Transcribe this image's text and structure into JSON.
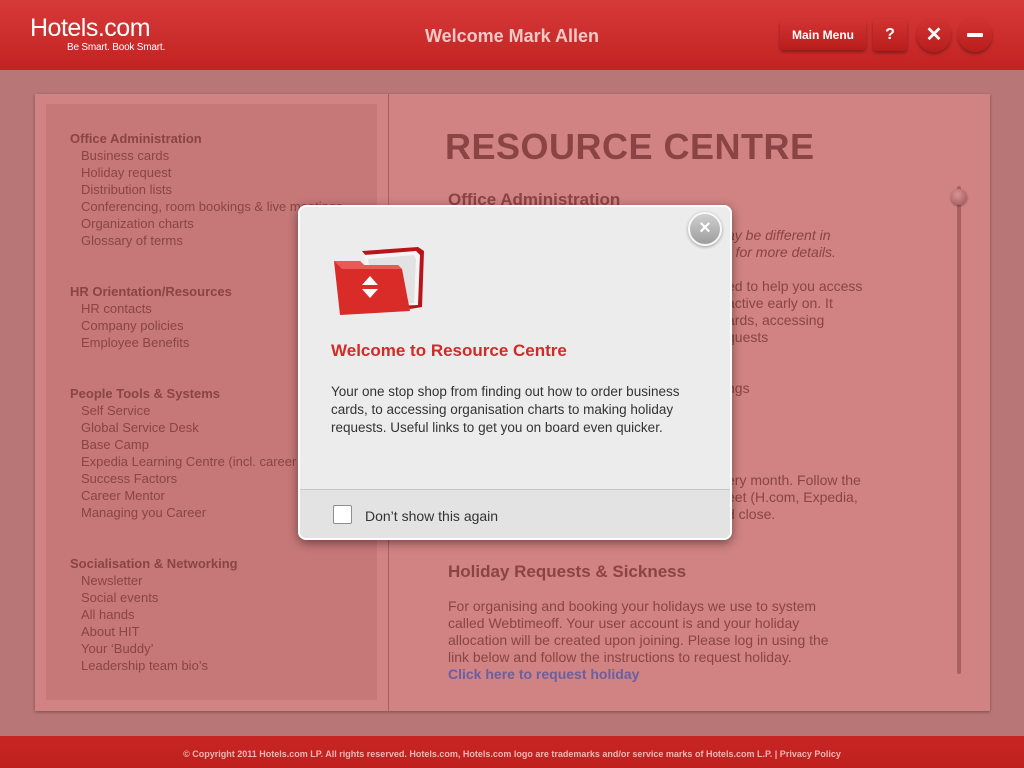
{
  "header": {
    "logo_main": "Hotels.com",
    "logo_tagline": "Be Smart. Book Smart.",
    "welcome": "Welcome Mark Allen",
    "main_menu_label": "Main Menu",
    "help_label": "?",
    "close_symbol": "✕"
  },
  "sidebar": {
    "sections": [
      {
        "heading": "Office Administration",
        "items": [
          "Business cards",
          "Holiday request",
          "Distribution lists",
          "Conferencing, room bookings & live meetings",
          "Organization charts",
          "Glossary of terms"
        ]
      },
      {
        "heading": "HR Orientation/Resources",
        "items": [
          "HR contacts",
          "Company policies",
          "Employee Benefits"
        ]
      },
      {
        "heading": "People Tools & Systems",
        "items": [
          "Self Service",
          "Global Service Desk",
          "Base Camp",
          "Expedia Learning Centre (incl. career",
          "Success Factors",
          "Career Mentor",
          "Managing you Career"
        ]
      },
      {
        "heading": "Socialisation & Networking",
        "items": [
          "Newsletter",
          "Social events",
          "All hands",
          "About HIT",
          "Your ‘Buddy’",
          "Leadership team bio’s"
        ]
      }
    ]
  },
  "content": {
    "title": "RESOURCE CENTRE",
    "section1_title": "Office Administration",
    "italic_lines": [
      "ay be different in",
      "r for more details."
    ],
    "para_lines": [
      "ed to help you access",
      "active early on.  It",
      "ards, accessing",
      "quests"
    ],
    "fragment": "ngs",
    "para2_lines": [
      "ery month. Follow the",
      "eet (H.com, Expedia,",
      "d close."
    ],
    "section2_title": "Holiday Requests & Sickness",
    "section2_lines": [
      "For organising and booking your holidays we use to system",
      "called Webtimeoff. Your user account is and your holiday",
      "allocation will be created upon joining. Please log in using the",
      "link below and follow the instructions to request holiday."
    ],
    "link": "Click here to request holiday"
  },
  "modal": {
    "title": "Welcome to Resource Centre",
    "body": "Your one stop shop from finding out how to order business cards, to accessing organisation charts to making holiday requests. Useful links to get you on board even quicker.",
    "checkbox_label": "Don’t show this again",
    "close_symbol": "×"
  },
  "footer": {
    "text": "© Copyright 2011 Hotels.com LP.  All rights reserved. Hotels.com, Hotels.com logo are trademarks and/or service marks of Hotels.com L.P.  |   Privacy Policy"
  },
  "colors": {
    "brand_red": "#c22322",
    "text_muted": "#8a4444",
    "modal_title": "#d12b27",
    "link": "#6a5fa0"
  },
  "icons": [
    "folder-icon",
    "close-icon",
    "help-icon",
    "minimize-icon",
    "checkbox-icon"
  ]
}
